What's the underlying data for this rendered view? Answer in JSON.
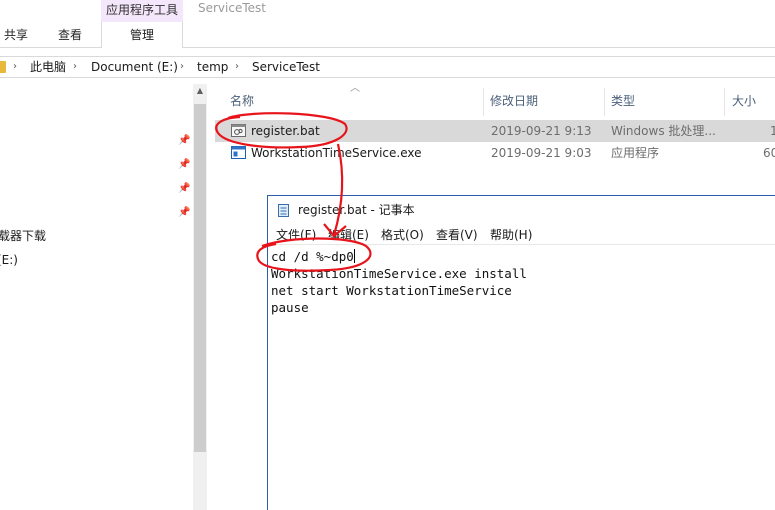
{
  "ribbon": {
    "context_header": "应用程序工具",
    "window_title": "ServiceTest",
    "tabs": [
      {
        "label": "共享"
      },
      {
        "label": "查看"
      }
    ],
    "context_tab": "管理"
  },
  "address": {
    "crumbs": [
      "此电脑",
      "Document (E:)",
      "temp",
      "ServiceTest"
    ]
  },
  "nav": {
    "items": [
      "载器下载",
      "(E:)"
    ]
  },
  "file_list": {
    "columns": [
      "名称",
      "修改日期",
      "类型",
      "大小"
    ],
    "rows": [
      {
        "name": "register.bat",
        "date": "2019-09-21 9:13",
        "type": "Windows 批处理...",
        "size": "1",
        "selected": true
      },
      {
        "name": "WorkstationTimeService.exe",
        "date": "2019-09-21 9:03",
        "type": "应用程序",
        "size": "60",
        "selected": false
      }
    ]
  },
  "notepad": {
    "title": "register.bat - 记事本",
    "menu": [
      "文件(F)",
      "编辑(E)",
      "格式(O)",
      "查看(V)",
      "帮助(H)"
    ],
    "lines": [
      "cd /d %~dp0",
      "WorkstationTimeService.exe install",
      "net start WorkstationTimeService",
      "pause"
    ]
  },
  "colors": {
    "annotation": "#e8141b",
    "selection": "#d9d9d9",
    "context_tab": "#f4e7fb",
    "notepad_border": "#2b5da8"
  },
  "icons": [
    "pin-icon",
    "folder-icon",
    "bat-file-icon",
    "exe-file-icon",
    "notepad-icon",
    "chevron-right-icon",
    "sort-up-icon"
  ]
}
